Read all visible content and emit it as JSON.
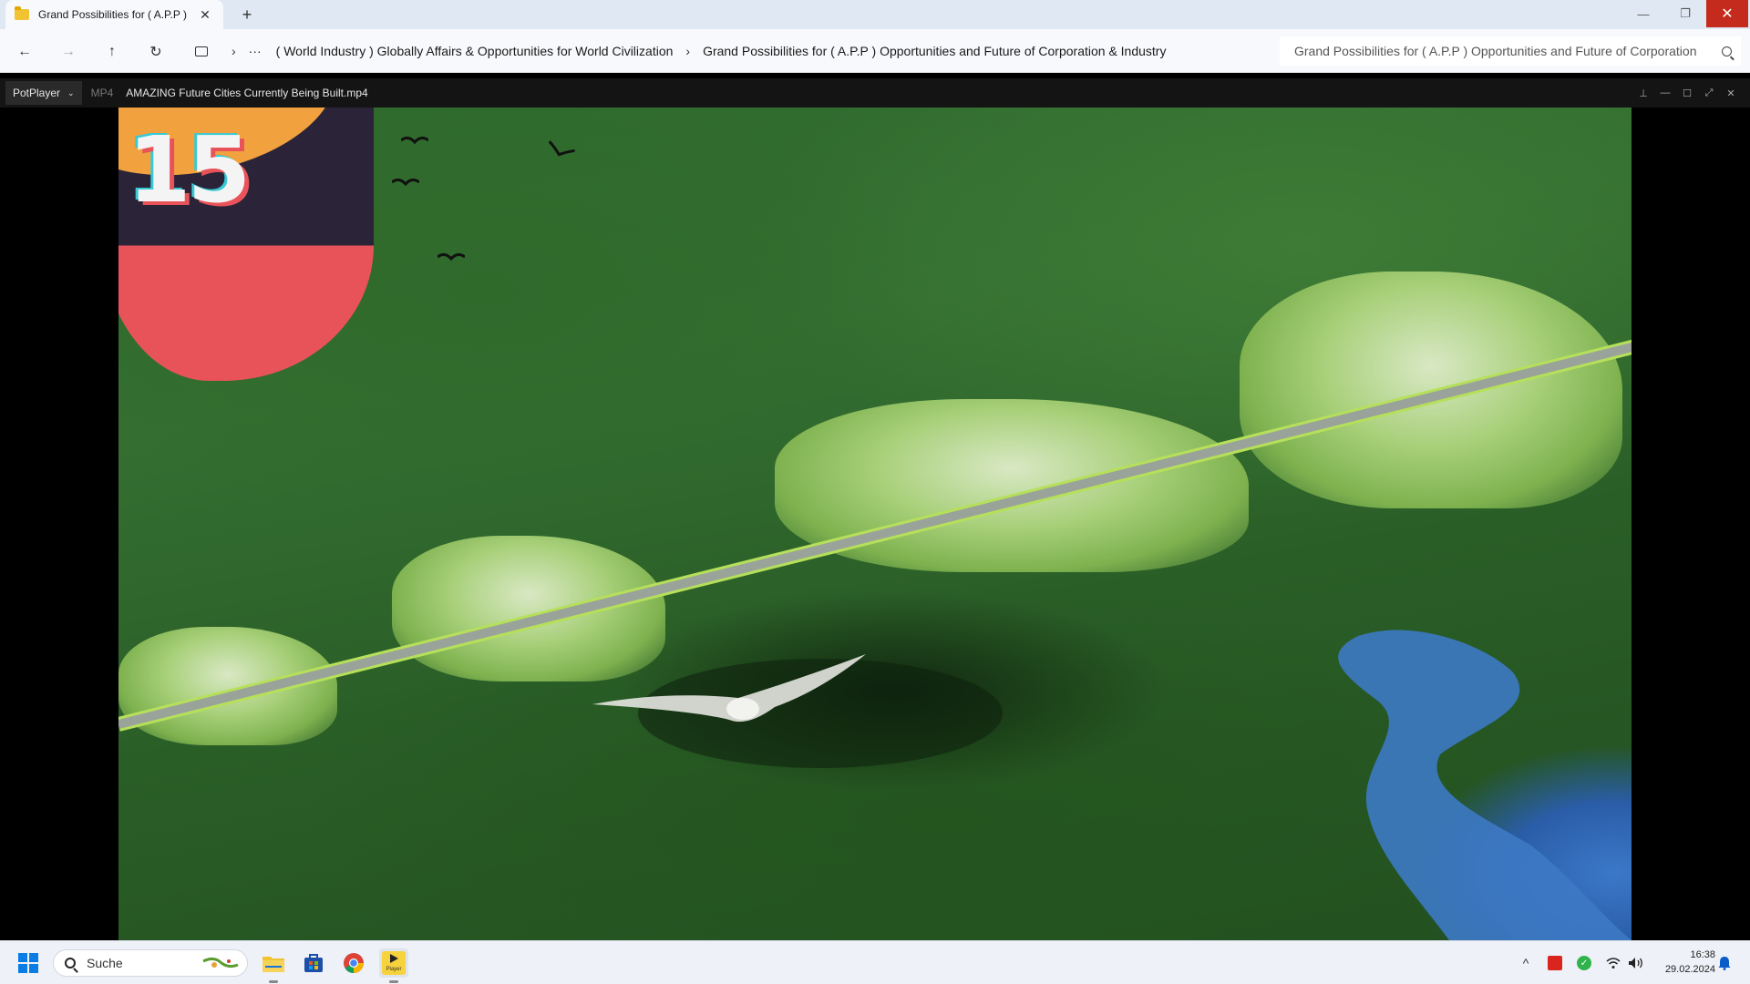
{
  "explorer": {
    "tab_title": "Grand Possibilities for ( A.P.P )",
    "tab_close": "✕",
    "new_tab": "+",
    "window_controls": {
      "minimize": "—",
      "restore": "❐",
      "close": "✕"
    },
    "nav": {
      "back": "←",
      "forward": "→",
      "up": "↑",
      "refresh": "↻",
      "overflow": "···",
      "chevron": "›"
    },
    "breadcrumbs": [
      "( World Industry ) Globally Affairs & Opportunities for World Civilization",
      "Grand Possibilities for ( A.P.P ) Opportunities and Future of Corporation & Industry"
    ],
    "search_value": "Grand Possibilities for ( A.P.P ) Opportunities and Future of Corporation"
  },
  "player": {
    "menu_label": "PotPlayer",
    "menu_caret": "⌄",
    "format": "MP4",
    "file_name": "AMAZING Future Cities Currently Being Built.mp4",
    "controls": {
      "pin": "⊥",
      "minimize": "—",
      "maximize": "☐",
      "fullscreen": "⤢",
      "close": "✕"
    },
    "overlay_number": "15"
  },
  "taskbar": {
    "search_label": "Suche",
    "apps": [
      "file-explorer",
      "microsoft-store",
      "chrome",
      "potplayer"
    ],
    "potplayer_label": "Player",
    "tray_chevron": "^",
    "time": "16:38",
    "date": "29.02.2024"
  },
  "colors": {
    "accent_blue": "#0a7ce6",
    "close_red": "#c42b1c",
    "folder_yellow": "#f1c232",
    "player_bar": "#141414"
  }
}
